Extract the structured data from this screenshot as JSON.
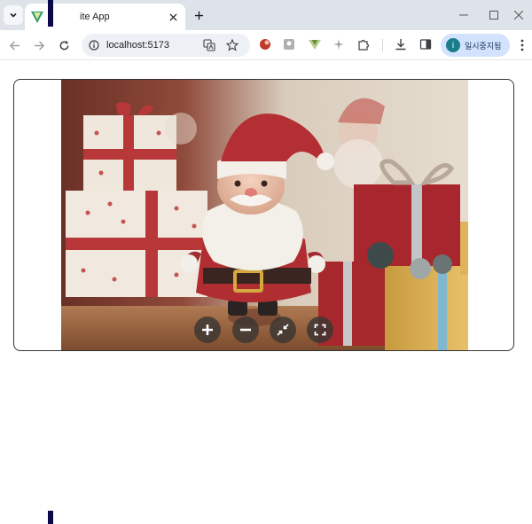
{
  "browser": {
    "tab": {
      "title": "ite App"
    },
    "address": {
      "url": "localhost:5173"
    },
    "profile": {
      "initial": "i",
      "label": "일시중지됨"
    }
  },
  "viewer": {
    "image": {
      "subject": "Santa Claus figurine with gift boxes"
    },
    "controls": [
      {
        "name": "zoom-in",
        "icon": "plus-icon"
      },
      {
        "name": "zoom-out",
        "icon": "minus-icon"
      },
      {
        "name": "exit-fullscreen",
        "icon": "shrink-arrows-icon"
      },
      {
        "name": "fullscreen",
        "icon": "fullscreen-icon"
      }
    ]
  },
  "colors": {
    "tabbar": "#dee3ea",
    "omnibox": "#edf1f6",
    "profile_pill": "#d3e3fd",
    "control_bg": "#3a3632"
  }
}
